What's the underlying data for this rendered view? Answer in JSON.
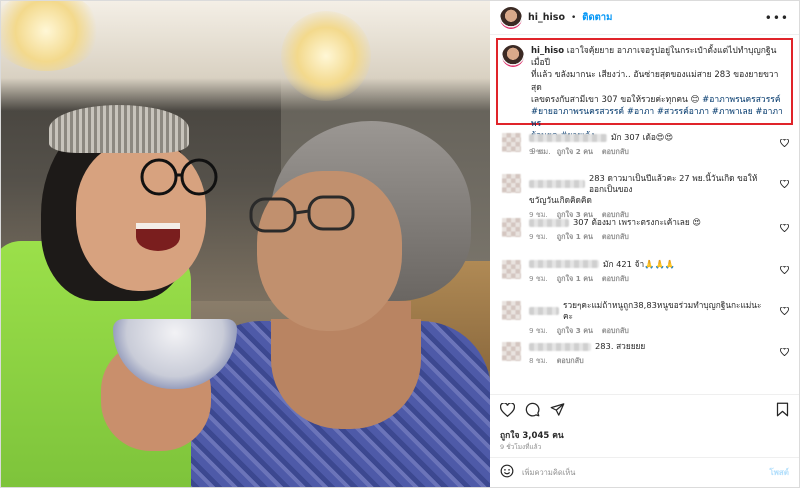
{
  "header": {
    "username": "hi_hiso",
    "separator": "•",
    "follow_label": "ติดตาม",
    "more_label": "•••"
  },
  "caption": {
    "username": "hi_hiso",
    "line1": "เอาใจคุ้ยยาย อาภาเจอรูปอยู่ในกระเป๋าตั้งแต่ไปทำบุญกฐินเมื่อปี",
    "line2": "ที่แล้ว ขลังมากนะ เสียงว่า.. อันซ่ายสุดของแม่สาย 283 ของยายขวาสุด",
    "line3": "เลขตรงกับสามีเขา 307 ขอให้รวยค่ะทุกคน 😊",
    "line3_tag": "#อาภาพรนครสวรรค์",
    "line4_tags": "#ยายอาภาพรนครสวรรค์ #อาภา #สวรรค์อาภา #ภาพาเลย #อาภาพร",
    "line5_tags": "ย้อนยุค #ยายเล้ง",
    "time": "9 ชม."
  },
  "comments": [
    {
      "text": "มัก 307 เด้อ😍😍",
      "time": "9 ชม.",
      "likes": "ถูกใจ 2 คน",
      "reply": "ตอบกลับ",
      "blur_w": 78
    },
    {
      "text": "283 ดาวมาเป็นปีแล้วคะ 27 พย.นี้วันเกิด ขอให้ออกเป็นของ",
      "text2": "ขวัญวันเกิดคิดคิด",
      "time": "9 ชม.",
      "likes": "ถูกใจ 3 คน",
      "reply": "ตอบกลับ",
      "blur_w": 56
    },
    {
      "text": "307 ต้องมา เพราะตรงกะเค้าเลย 😍",
      "time": "9 ชม.",
      "likes": "ถูกใจ 1 คน",
      "reply": "ตอบกลับ",
      "blur_w": 40
    },
    {
      "text": "มัก 421 จ้า🙏🙏🙏",
      "time": "9 ชม.",
      "likes": "ถูกใจ 1 คน",
      "reply": "ตอบกลับ",
      "blur_w": 70
    },
    {
      "text": "รวยๆคะแม่ถ้าหนูถูก38,83หนูขอร่วมทำบุญกฐินกะแม่นะคะ",
      "time": "9 ชม.",
      "likes": "ถูกใจ 3 คน",
      "reply": "ตอบกลับ",
      "blur_w": 30
    },
    {
      "text": "283. สวยยยย",
      "time": "8 ชม.",
      "likes": "",
      "reply": "ตอบกลับ",
      "blur_w": 62
    }
  ],
  "actions": {
    "likes": "ถูกใจ 3,045 คน",
    "ago": "9 ชั่วโมงที่แล้ว",
    "add_comment_placeholder": "เพิ่มความคิดเห็น",
    "post_label": "โพสต์"
  }
}
